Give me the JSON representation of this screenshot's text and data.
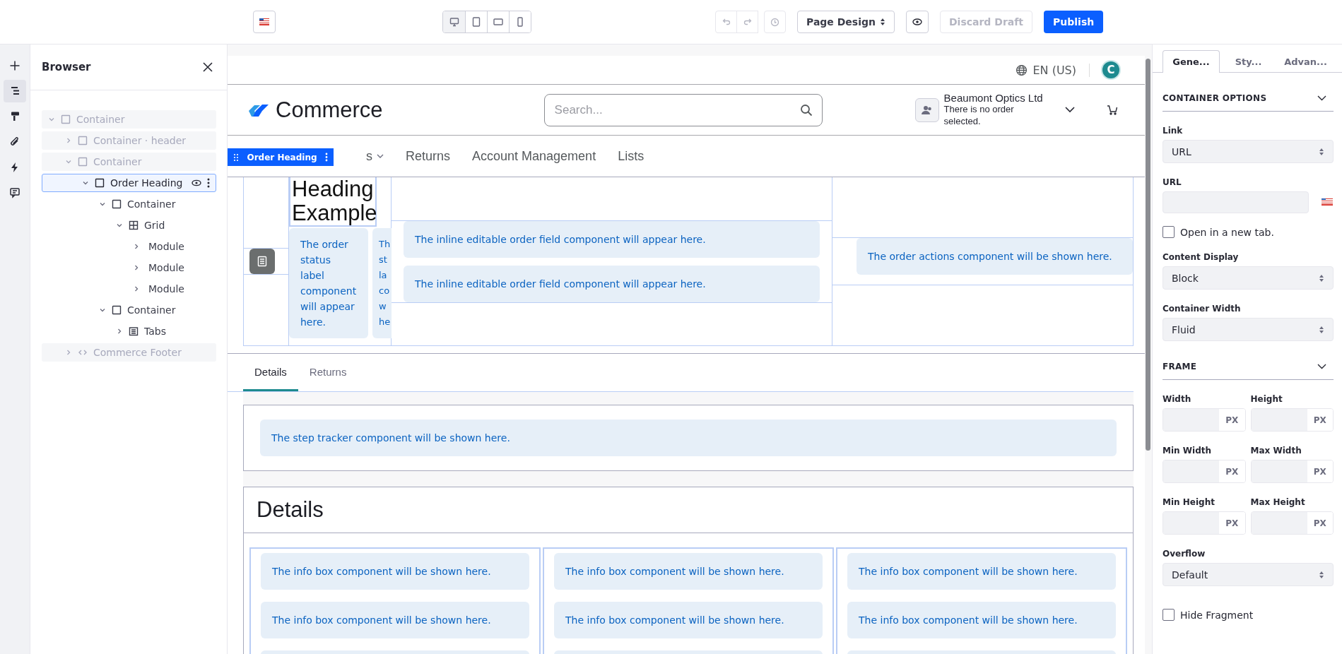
{
  "toolbar": {
    "devices": [
      {
        "kind": "desktop",
        "selected": true
      },
      {
        "kind": "tablet",
        "selected": false
      },
      {
        "kind": "landscape",
        "selected": false
      },
      {
        "kind": "phone",
        "selected": false
      }
    ],
    "undo_disabled": true,
    "redo_disabled": true,
    "history_disabled": true,
    "mode": "Page Design",
    "discard": {
      "label": "Discard Draft",
      "disabled": true
    },
    "publish": "Publish"
  },
  "rail": [
    {
      "kind": "add",
      "selected": false
    },
    {
      "kind": "browser",
      "selected": true
    },
    {
      "kind": "styles",
      "selected": false
    },
    {
      "kind": "mappings",
      "selected": false
    },
    {
      "kind": "interactions",
      "selected": false
    },
    {
      "kind": "comments",
      "selected": false
    }
  ],
  "browser": {
    "title": "Browser",
    "tree": [
      {
        "label": "Container",
        "kind": "container",
        "dimmed": true,
        "selected": false,
        "expanded": true,
        "children": [
          {
            "label": "Container · header",
            "kind": "container",
            "dimmed": true,
            "selected": false,
            "expanded": false
          },
          {
            "label": "Container",
            "kind": "container",
            "dimmed": true,
            "selected": false,
            "expanded": true,
            "children": [
              {
                "label": "Order Heading",
                "kind": "container",
                "dimmed": false,
                "selected": true,
                "expanded": true,
                "children": [
                  {
                    "label": "Container",
                    "kind": "container",
                    "dimmed": false,
                    "selected": false,
                    "expanded": true,
                    "children": [
                      {
                        "label": "Grid",
                        "kind": "grid",
                        "dimmed": false,
                        "selected": false,
                        "expanded": true,
                        "children": [
                          {
                            "label": "Module",
                            "dimmed": false,
                            "selected": false,
                            "expanded": false
                          },
                          {
                            "label": "Module",
                            "dimmed": false,
                            "selected": false,
                            "expanded": false
                          },
                          {
                            "label": "Module",
                            "dimmed": false,
                            "selected": false,
                            "expanded": false
                          }
                        ]
                      }
                    ]
                  },
                  {
                    "label": "Container",
                    "kind": "container",
                    "dimmed": false,
                    "selected": false,
                    "expanded": true,
                    "children": [
                      {
                        "label": "Tabs",
                        "kind": "tabs",
                        "dimmed": false,
                        "selected": false,
                        "expanded": false
                      }
                    ]
                  }
                ]
              }
            ]
          },
          {
            "label": "Commerce Footer",
            "kind": "code",
            "dimmed": true,
            "selected": false,
            "expanded": false
          }
        ]
      }
    ]
  },
  "site": {
    "language": "EN (US)",
    "avatar": "C",
    "logo": "Commerce",
    "search_placeholder": "Search...",
    "account": {
      "name": "Beaumont Optics Ltd",
      "note": "There is no order selected."
    },
    "nav": [
      {
        "label": "s",
        "has_menu": true
      },
      {
        "label": "Returns",
        "has_menu": false
      },
      {
        "label": "Account Management",
        "has_menu": false
      },
      {
        "label": "Lists",
        "has_menu": false
      }
    ],
    "fragment_label": "Order Heading"
  },
  "order_heading": {
    "title": "Heading Example",
    "status_labels": [
      {
        "lines": [
          "The order",
          "status",
          "label",
          "component",
          "will appear",
          "here."
        ]
      },
      {
        "lines": [
          "Th",
          "st",
          "la",
          "co",
          "w",
          "he"
        ]
      }
    ],
    "inline_fields": [
      "The inline editable order field component will appear here.",
      "The inline editable order field component will appear here."
    ],
    "order_actions": "The order actions component will be shown here."
  },
  "tabs": [
    {
      "label": "Details",
      "selected": true
    },
    {
      "label": "Returns",
      "selected": false
    }
  ],
  "step_tracker": "The step tracker component will be shown here.",
  "details": {
    "title": "Details",
    "columns": [
      [
        "The info box component will be shown here.",
        "The info box component will be shown here."
      ],
      [
        "The info box component will be shown here.",
        "The info box component will be shown here."
      ],
      [
        "The info box component will be shown here.",
        "The info box component will be shown here."
      ]
    ]
  },
  "panel": {
    "tabs": [
      {
        "label": "Gene...",
        "selected": true
      },
      {
        "label": "Sty...",
        "selected": false
      },
      {
        "label": "Advan...",
        "selected": false
      }
    ],
    "sections": [
      {
        "title": "CONTAINER OPTIONS",
        "expanded": true,
        "fields": [
          {
            "kind": "select",
            "label": "Link",
            "value": "URL"
          },
          {
            "kind": "localized",
            "label": "URL"
          },
          {
            "kind": "checkbox",
            "label": "Open in a new tab.",
            "checked": false
          },
          {
            "kind": "select",
            "label": "Content Display",
            "value": "Block"
          },
          {
            "kind": "select",
            "label": "Container Width",
            "value": "Fluid"
          }
        ]
      },
      {
        "title": "FRAME",
        "expanded": true,
        "fields": [
          {
            "kind": "pair",
            "items": [
              {
                "label": "Width",
                "unit": "PX"
              },
              {
                "label": "Height",
                "unit": "PX"
              }
            ]
          },
          {
            "kind": "pair",
            "items": [
              {
                "label": "Min Width",
                "unit": "PX"
              },
              {
                "label": "Max Width",
                "unit": "PX"
              }
            ]
          },
          {
            "kind": "pair",
            "items": [
              {
                "label": "Min Height",
                "unit": "PX"
              },
              {
                "label": "Max Height",
                "unit": "PX"
              }
            ]
          },
          {
            "kind": "select",
            "label": "Overflow",
            "value": "Default"
          },
          {
            "kind": "checkbox",
            "label": "Hide Fragment",
            "checked": false
          }
        ]
      }
    ]
  }
}
